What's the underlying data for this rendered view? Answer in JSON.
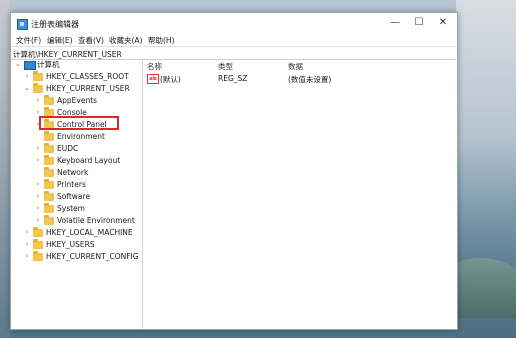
{
  "window": {
    "title": "注册表编辑器",
    "minimize": "—",
    "maximize": "☐",
    "close": "✕"
  },
  "menu": [
    "文件(F)",
    "编辑(E)",
    "查看(V)",
    "收藏夹(A)",
    "帮助(H)"
  ],
  "address": "计算机\\HKEY_CURRENT_USER",
  "tree": {
    "root": "计算机",
    "hkcr": "HKEY_CLASSES_ROOT",
    "hkcu": "HKEY_CURRENT_USER",
    "children": [
      "AppEvents",
      "Console",
      "Control Panel",
      "Environment",
      "EUDC",
      "Keyboard Layout",
      "Network",
      "Printers",
      "Software",
      "System",
      "Volatile Environment"
    ],
    "hklm": "HKEY_LOCAL_MACHINE",
    "hku": "HKEY_USERS",
    "hkcc": "HKEY_CURRENT_CONFIG"
  },
  "list": {
    "headers": {
      "name": "名称",
      "type": "类型",
      "data": "数据"
    },
    "rows": [
      {
        "icon": "ab",
        "name": "(默认)",
        "type": "REG_SZ",
        "data": "(数值未设置)"
      }
    ]
  },
  "colors": {
    "highlight": "#e3252b",
    "folder": "#f3c54f",
    "computer": "#2e86d6"
  }
}
